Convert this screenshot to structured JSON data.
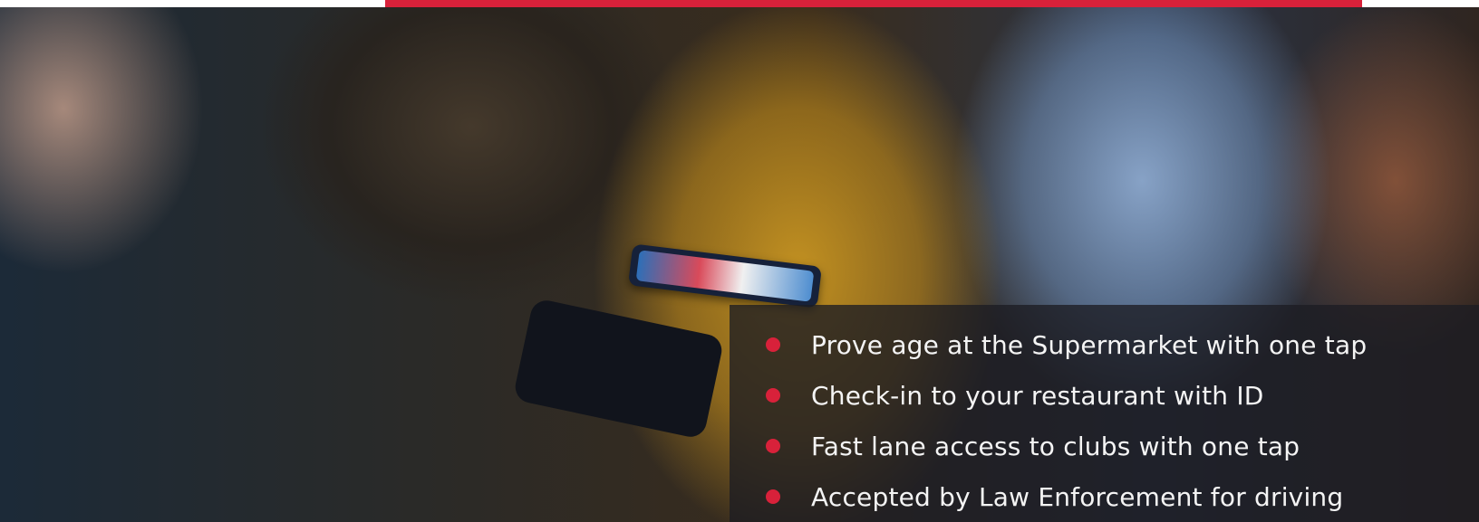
{
  "colors": {
    "accent": "#d8213a",
    "panel": "#1c1c22",
    "text": "#f4f4f4"
  },
  "hero": {
    "icon": "bullet-dot",
    "features": [
      "Prove age at the Supermarket with one tap",
      "Check-in to your restaurant with ID",
      "Fast lane access to clubs with one tap",
      "Accepted by Law Enforcement for driving"
    ]
  }
}
